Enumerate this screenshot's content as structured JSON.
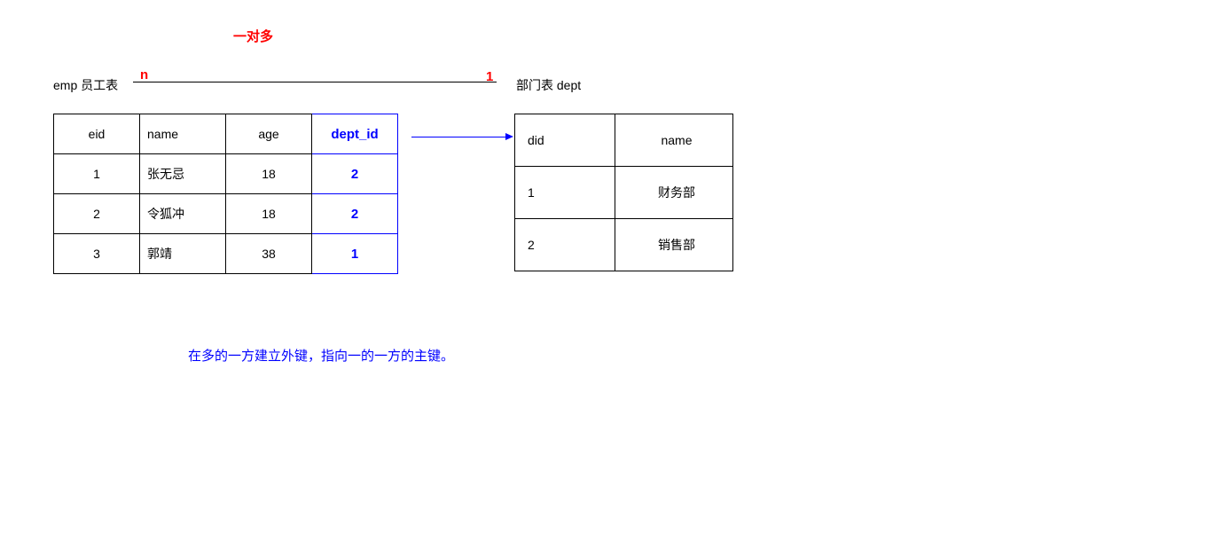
{
  "title": "一对多",
  "rel": {
    "left": "n",
    "right": "1"
  },
  "emp": {
    "label": "emp 员工表",
    "headers": {
      "eid": "eid",
      "name": "name",
      "age": "age",
      "dept_id": "dept_id"
    },
    "rows": [
      {
        "eid": "1",
        "name": "张无忌",
        "age": "18",
        "dept_id": "2"
      },
      {
        "eid": "2",
        "name": "令狐冲",
        "age": "18",
        "dept_id": "2"
      },
      {
        "eid": "3",
        "name": "郭靖",
        "age": "38",
        "dept_id": "1"
      }
    ]
  },
  "dept": {
    "label": "部门表 dept",
    "headers": {
      "did": "did",
      "name": "name"
    },
    "rows": [
      {
        "did": "1",
        "name": "财务部"
      },
      {
        "did": "2",
        "name": "销售部"
      }
    ]
  },
  "note": "在多的一方建立外键，指向一的一方的主键。"
}
